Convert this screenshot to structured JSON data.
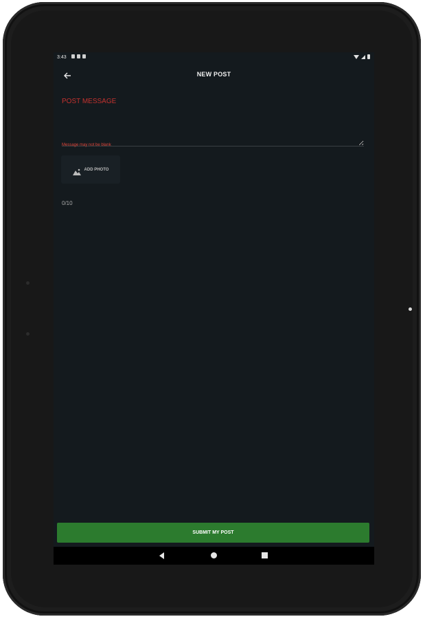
{
  "status_bar": {
    "time": "3:43"
  },
  "toolbar": {
    "title": "NEW POST"
  },
  "form": {
    "message_label": "POST MESSAGE",
    "message_value": "",
    "error_text": "Message may not be blank",
    "add_photo_label": "ADD PHOTO",
    "char_counter": "0/10"
  },
  "actions": {
    "submit_label": "SUBMIT MY POST"
  },
  "colors": {
    "accent_error": "#c4322f",
    "submit_green": "#2c7b2e",
    "screen_background": "#141a1e"
  },
  "icons": [
    "back-arrow-icon",
    "image-icon",
    "wifi-icon",
    "signal-icon",
    "battery-icon",
    "nav-back-icon",
    "nav-home-icon",
    "nav-recents-icon"
  ]
}
